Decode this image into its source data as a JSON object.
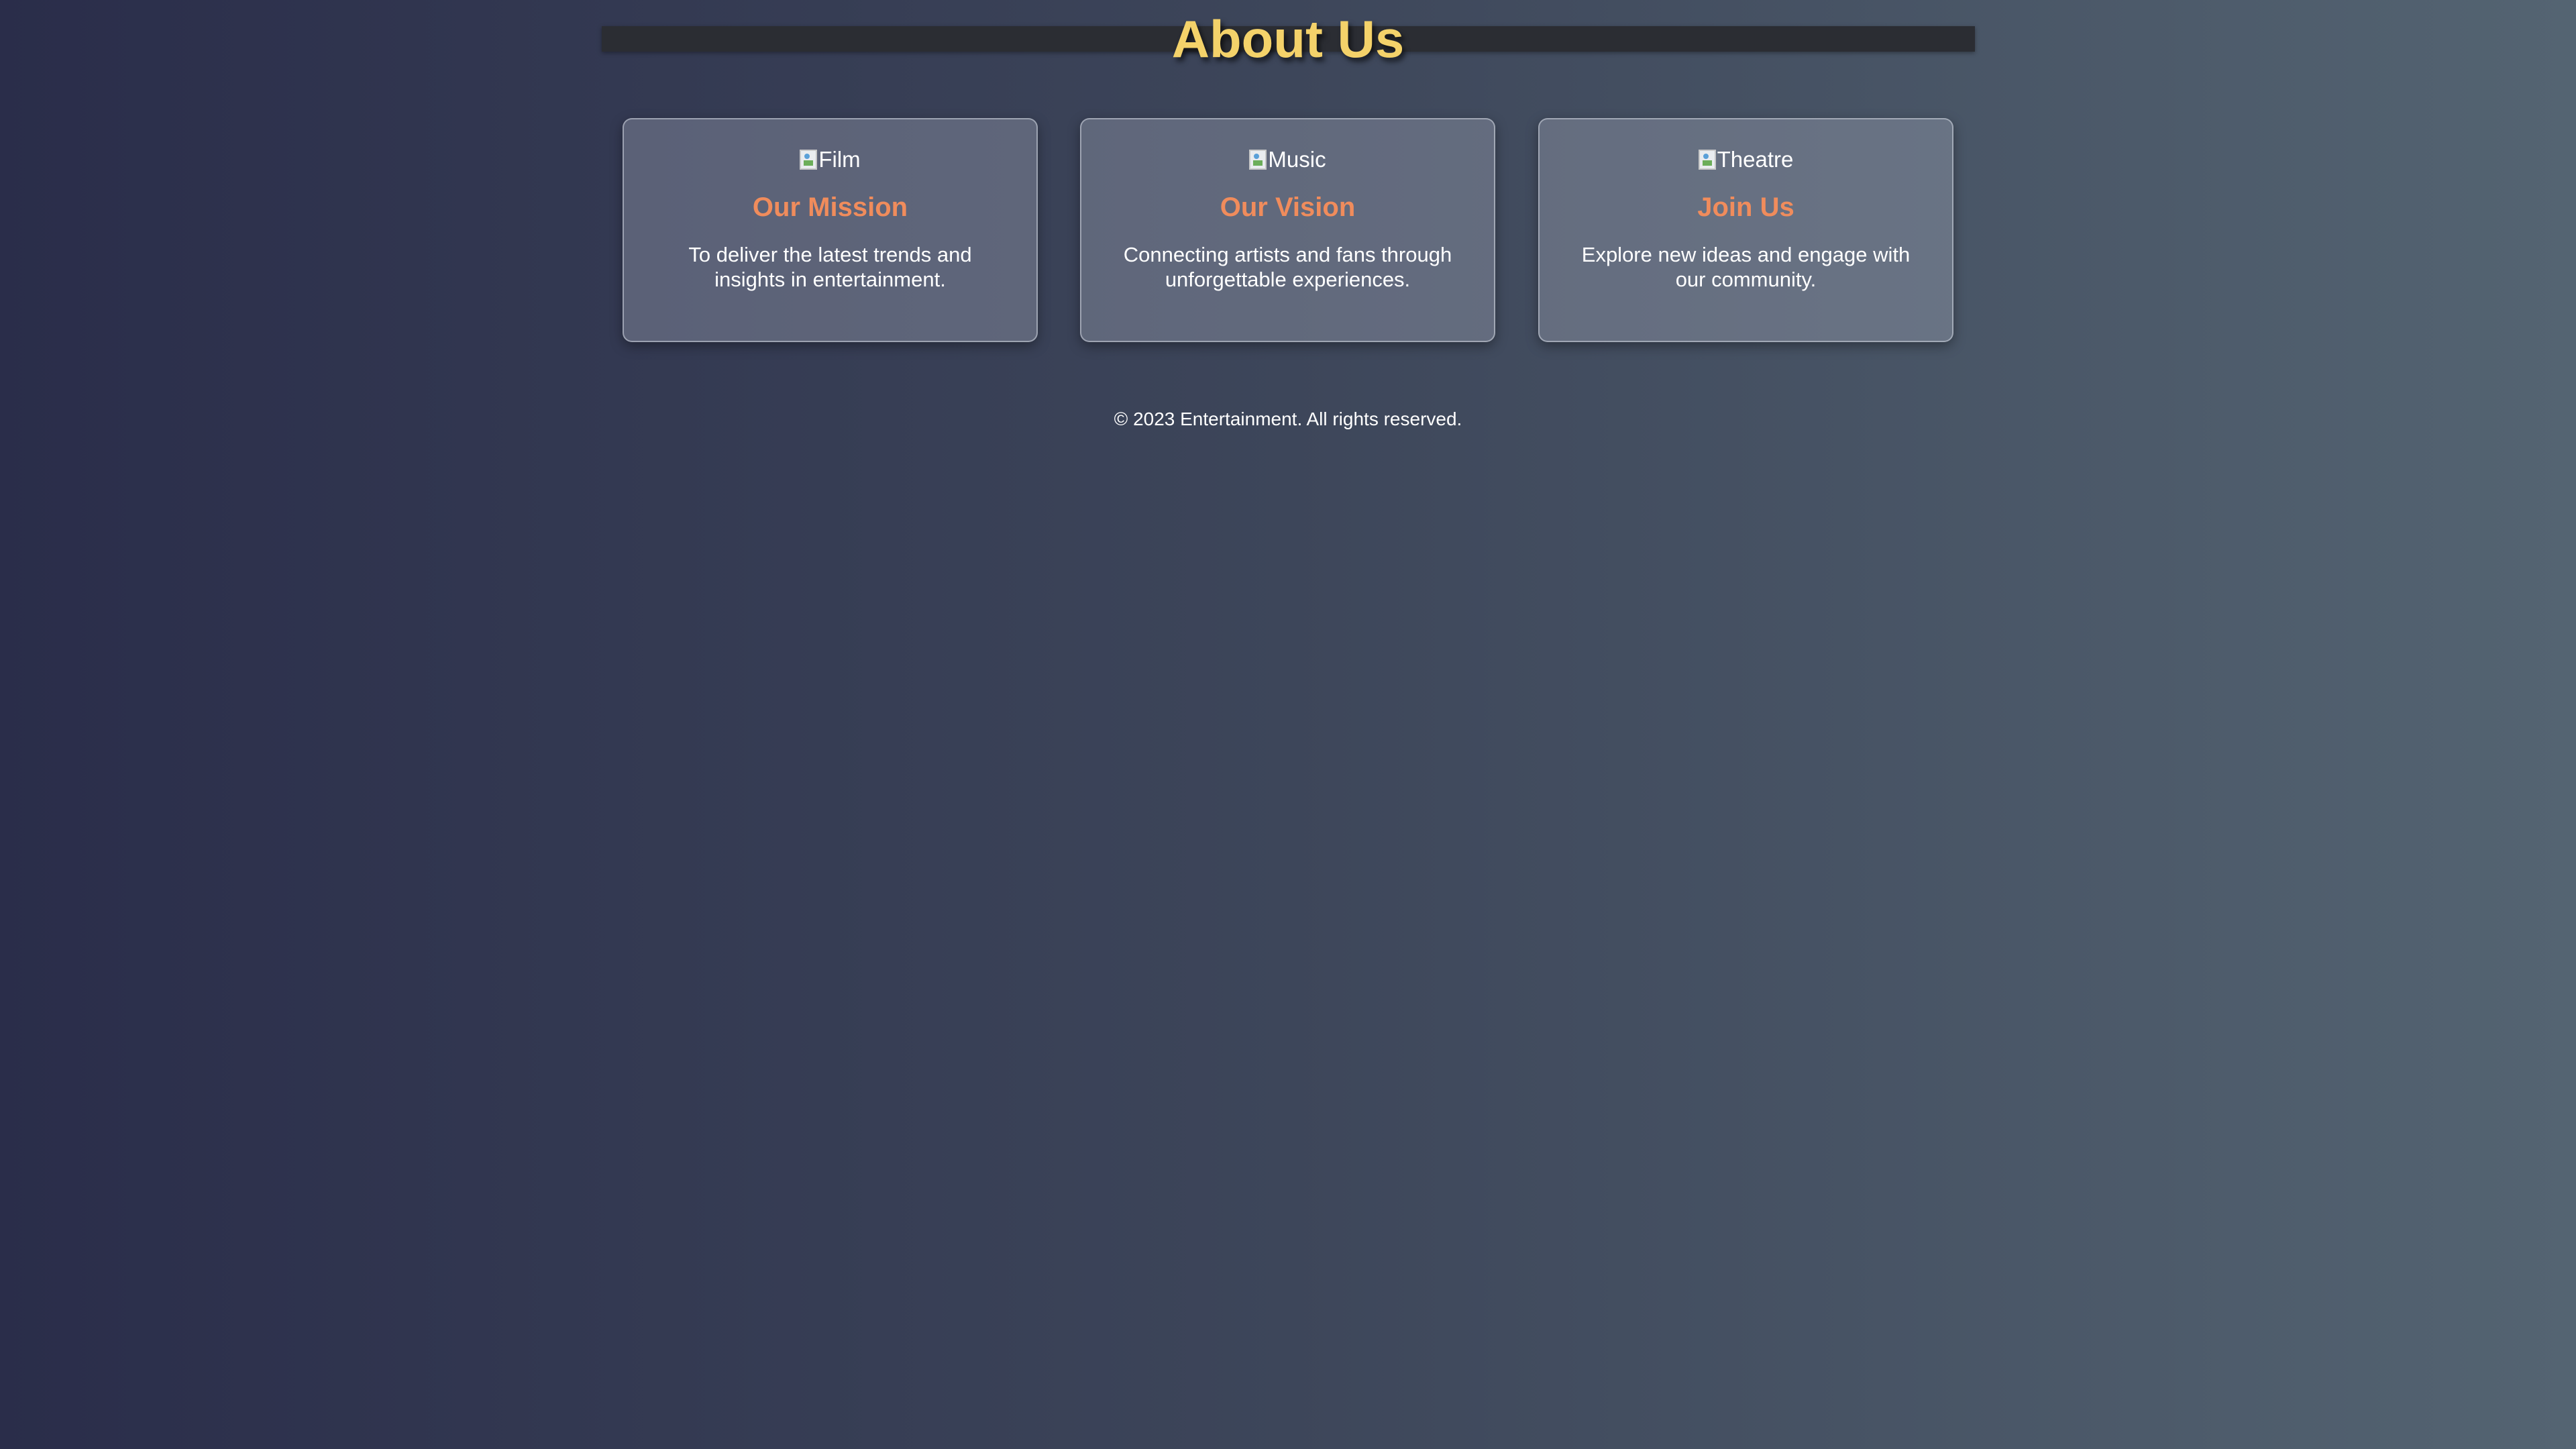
{
  "header": {
    "title": "About Us"
  },
  "cards": [
    {
      "image_alt": "Film",
      "icon": "broken-image-icon",
      "title": "Our Mission",
      "text": "To deliver the latest trends and insights in entertainment."
    },
    {
      "image_alt": "Music",
      "icon": "broken-image-icon",
      "title": "Our Vision",
      "text": "Connecting artists and fans through unforgettable experiences."
    },
    {
      "image_alt": "Theatre",
      "icon": "broken-image-icon",
      "title": "Join Us",
      "text": "Explore new ideas and engage with our community."
    }
  ],
  "footer": {
    "text": "© 2023 Entertainment. All rights reserved."
  },
  "colors": {
    "title": "#f4d26a",
    "card_heading": "#f08c5c",
    "header_bar": "#2b2d33",
    "background_start": "#2a2d4a",
    "background_end": "#546472"
  }
}
